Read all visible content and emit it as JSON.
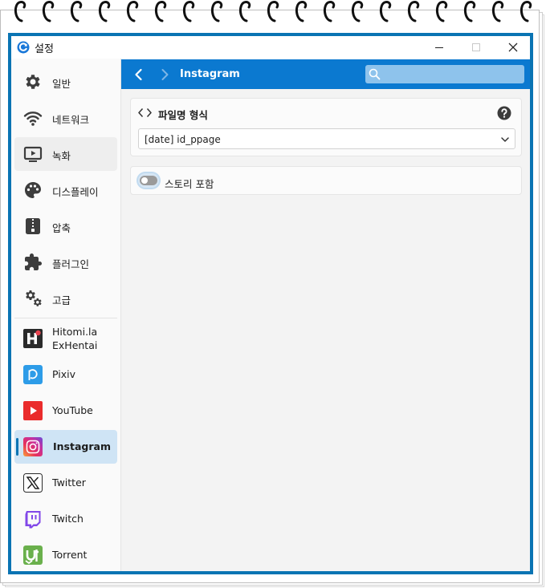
{
  "window": {
    "title": "설정"
  },
  "sidebar": {
    "items": [
      {
        "label": "일반",
        "icon": "gear-icon"
      },
      {
        "label": "네트워크",
        "icon": "wifi-icon"
      },
      {
        "label": "녹화",
        "icon": "recording-icon"
      },
      {
        "label": "디스플레이",
        "icon": "palette-icon"
      },
      {
        "label": "압축",
        "icon": "archive-icon"
      },
      {
        "label": "플러그인",
        "icon": "puzzle-icon"
      },
      {
        "label": "고급",
        "icon": "gears-icon"
      },
      {
        "label": "Hitomi.la\nExHentai",
        "icon": "hitomi-logo-icon"
      },
      {
        "label": "Pixiv",
        "icon": "pixiv-logo-icon"
      },
      {
        "label": "YouTube",
        "icon": "youtube-logo-icon"
      },
      {
        "label": "Instagram",
        "icon": "instagram-logo-icon"
      },
      {
        "label": "Twitter",
        "icon": "twitter-logo-icon"
      },
      {
        "label": "Twitch",
        "icon": "twitch-logo-icon"
      },
      {
        "label": "Torrent",
        "icon": "utorrent-logo-icon"
      }
    ],
    "selected": "Instagram"
  },
  "header": {
    "title": "Instagram",
    "search_placeholder": ""
  },
  "filename_format": {
    "title": "파일명 형식",
    "value": "[date] id_ppage"
  },
  "include_stories": {
    "label": "스토리 포함",
    "enabled": false
  },
  "colors": {
    "accent": "#0b79d0",
    "frame": "#0a74b3",
    "selected_bg": "#cfe4f5"
  }
}
